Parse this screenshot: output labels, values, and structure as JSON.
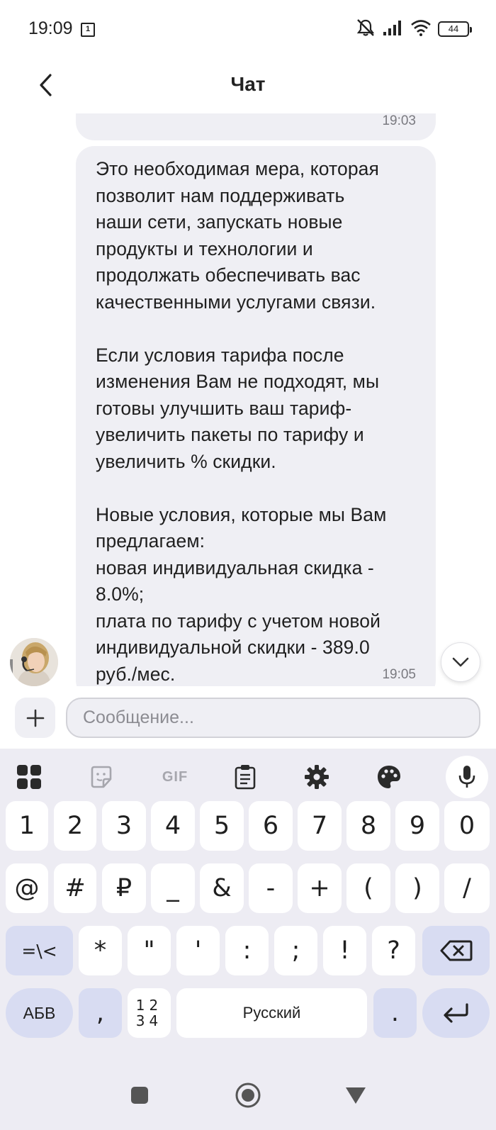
{
  "status_bar": {
    "time": "19:09",
    "sim_label": "1",
    "battery": "44"
  },
  "header": {
    "title": "Чат"
  },
  "chat": {
    "previous_message": {
      "time": "19:03"
    },
    "message": {
      "text": "Это необходимая мера, которая\nпозволит нам поддерживать\nнаши сети, запускать новые\nпродукты и технологии и\nпродолжать обеспечивать вас\nкачественными услугами связи.\n\nЕсли условия тарифа после\nизменения Вам не подходят, мы\nготовы улучшить ваш тариф-\nувеличить пакеты по тарифу и\nувеличить % скидки.\n\nНовые условия, которые мы Вам\nпредлагаем:\nновая индивидуальная скидка -\n8.0%;\nплата по тарифу с учетом новой\nиндивидуальной скидки - 389.0\nруб./мес.",
      "time": "19:05"
    }
  },
  "composer": {
    "placeholder": "Сообщение..."
  },
  "keyboard": {
    "toolbar": {
      "gif_label": "GIF"
    },
    "row1": [
      "1",
      "2",
      "3",
      "4",
      "5",
      "6",
      "7",
      "8",
      "9",
      "0"
    ],
    "row2": [
      "@",
      "#",
      "₽",
      "_",
      "&",
      "-",
      "+",
      "(",
      ")",
      "/"
    ],
    "row3": {
      "shift_label": "=\\<",
      "keys": [
        "*",
        "\"",
        "'",
        ":",
        ";",
        "!",
        "?"
      ]
    },
    "row4": {
      "abc_label": "АБВ",
      "comma": ",",
      "numpad_top": "12",
      "numpad_bottom": "34",
      "space_label": "Русский",
      "period": "."
    }
  },
  "colors": {
    "bubble": "#efeff4",
    "keyboard_bg": "#edecf3",
    "fn_key": "#d8dcf2",
    "accent_text": "#1f1f1f"
  }
}
